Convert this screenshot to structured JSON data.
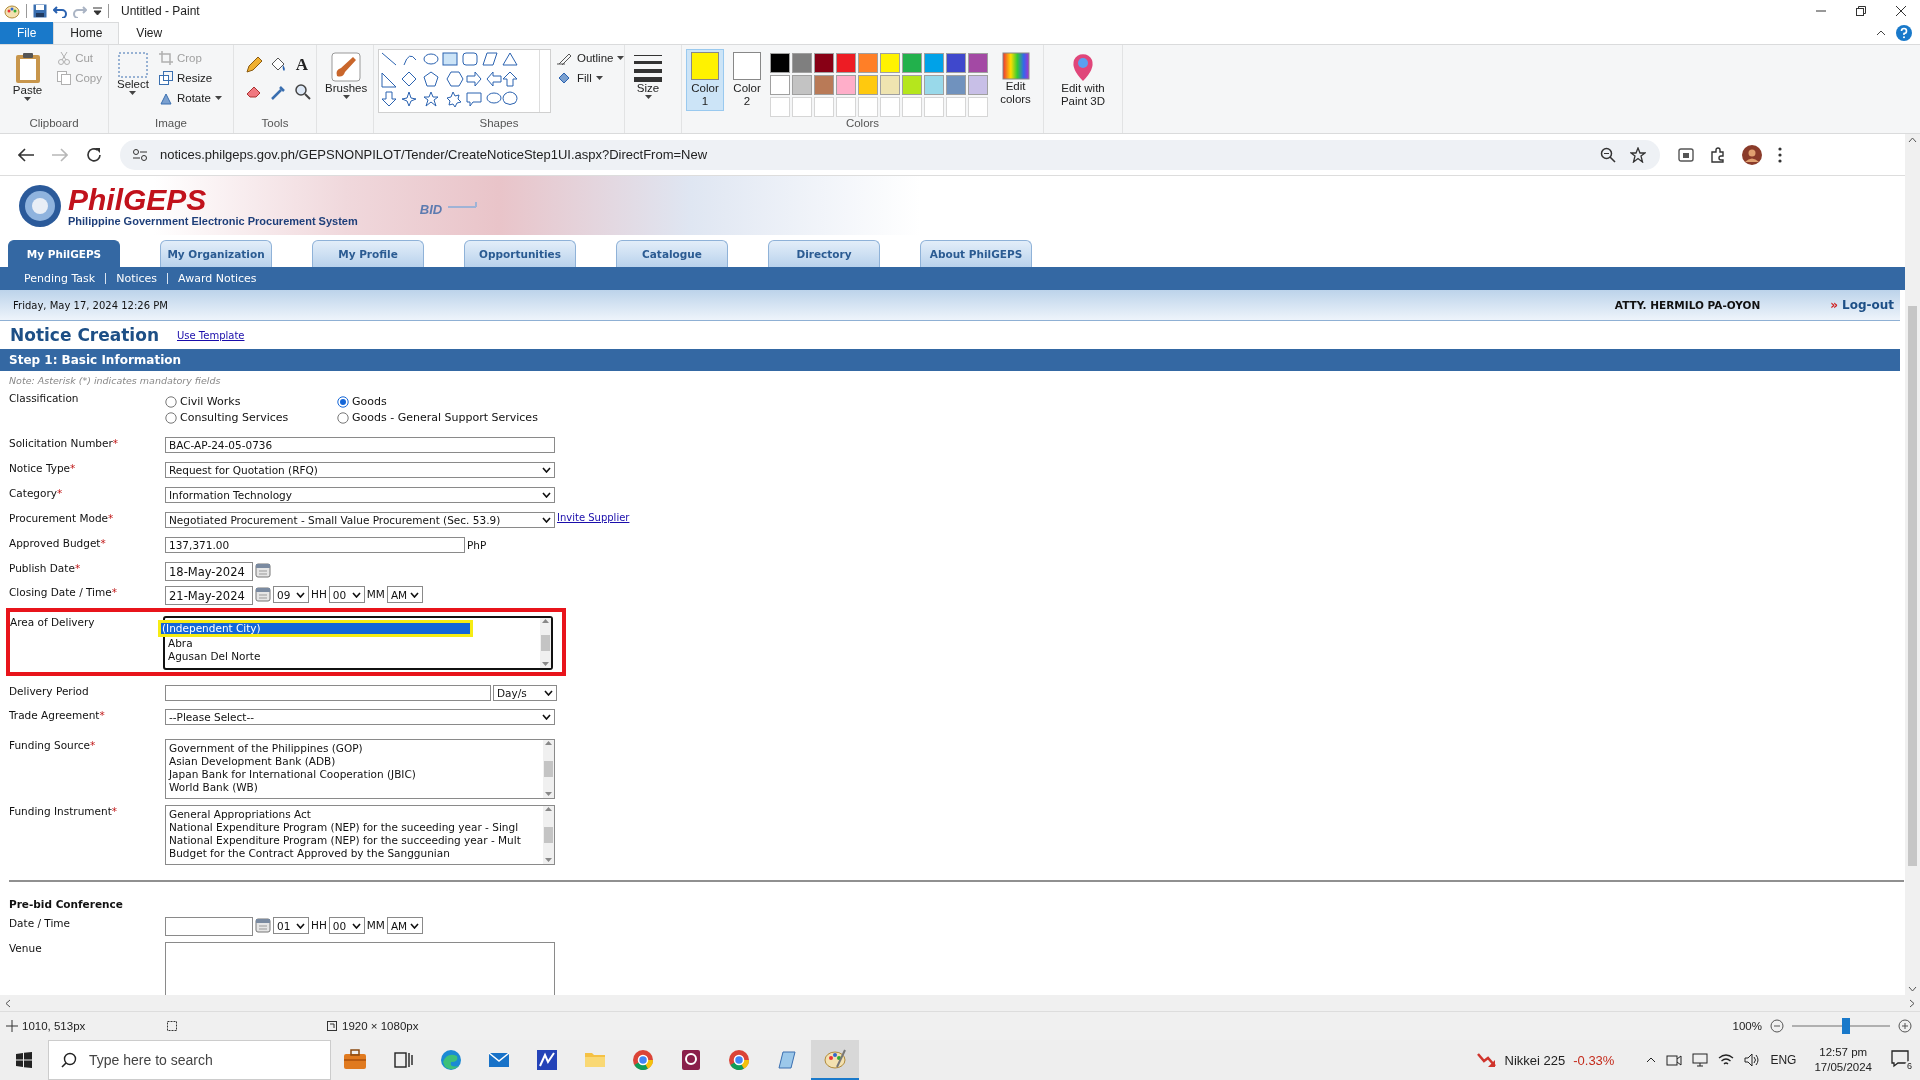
{
  "paint": {
    "title": "Untitled - Paint",
    "menu_tabs": [
      {
        "label": "File",
        "kind": "file",
        "selected": false
      },
      {
        "label": "Home",
        "kind": "tab",
        "selected": true
      },
      {
        "label": "View",
        "kind": "tab",
        "selected": false
      }
    ],
    "ribbon": {
      "paste": "Paste",
      "cut": {
        "label": "Cut",
        "disabled": true
      },
      "copy": {
        "label": "Copy",
        "disabled": true
      },
      "clipboard_label": "Clipboard",
      "select": "Select",
      "crop": {
        "label": "Crop",
        "disabled": true
      },
      "resize": {
        "label": "Resize",
        "disabled": false
      },
      "rotate": {
        "label": "Rotate",
        "disabled": false
      },
      "image_label": "Image",
      "text_tool": "A",
      "tools_label": "Tools",
      "brushes": "Brushes",
      "outline": "Outline",
      "fill": "Fill",
      "shapes_label": "Shapes",
      "size": "Size",
      "color1": {
        "label": "Color 1",
        "color": "#fff200",
        "selected": true
      },
      "color2": {
        "label": "Color 2",
        "color": "#ffffff",
        "selected": false
      },
      "palette": [
        {
          "color": "#000000"
        },
        {
          "color": "#7f7f7f"
        },
        {
          "color": "#880015"
        },
        {
          "color": "#ed1c24"
        },
        {
          "color": "#ff7f27"
        },
        {
          "color": "#fff200"
        },
        {
          "color": "#22b14c"
        },
        {
          "color": "#00a2e8"
        },
        {
          "color": "#3f48cc"
        },
        {
          "color": "#a349a4"
        },
        {
          "color": "#ffffff"
        },
        {
          "color": "#c3c3c3"
        },
        {
          "color": "#b97a57"
        },
        {
          "color": "#ffaec9"
        },
        {
          "color": "#ffc90e"
        },
        {
          "color": "#efe4b0"
        },
        {
          "color": "#b5e61d"
        },
        {
          "color": "#99d9ea"
        },
        {
          "color": "#7092be"
        },
        {
          "color": "#c8bfe7"
        }
      ],
      "edit_colors": "Edit colors",
      "colors_label": "Colors",
      "paint3d": "Edit with Paint 3D"
    }
  },
  "browser": {
    "url": "notices.philgeps.gov.ph/GEPSNONPILOT/Tender/CreateNoticeStep1UI.aspx?DirectFrom=New",
    "forward_disabled": true
  },
  "site": {
    "logo_title": "PhilGEPS",
    "logo_subtitle": "Philippine Government Electronic Procurement System",
    "banner_text": "BID",
    "tabs": [
      {
        "label": "My PhilGEPS",
        "selected": true
      },
      {
        "label": "My Organization",
        "selected": false
      },
      {
        "label": "My Profile",
        "selected": false
      },
      {
        "label": "Opportunities",
        "selected": false
      },
      {
        "label": "Catalogue",
        "selected": false
      },
      {
        "label": "Directory",
        "selected": false
      },
      {
        "label": "About PhilGEPS",
        "selected": false
      }
    ],
    "subnav": [
      "Pending Task",
      "Notices",
      "Award Notices"
    ],
    "date": "Friday, May 17, 2024 12:26 PM",
    "user": "ATTY. HERMILO PA-OYON",
    "logout_mark": "»",
    "logout": "Log-out",
    "heading": "Notice Creation",
    "template_link": "Use Template",
    "step": "Step 1: Basic Information",
    "note": "Note: Asterisk (*) indicates mandatory fields",
    "fields": [
      {
        "kind": "radio",
        "label": "Classification",
        "annotated": false,
        "options": [
          {
            "label": "Civil Works",
            "selected": false
          },
          {
            "label": "Goods",
            "selected": true
          },
          {
            "label": "Consulting Services",
            "selected": false
          },
          {
            "label": "Goods - General Support Services",
            "selected": false
          }
        ]
      },
      {
        "kind": "text",
        "label": "Solicitation Number",
        "mark": "*",
        "annotated": false,
        "value": "BAC-AP-24-05-0736"
      },
      {
        "kind": "select",
        "label": "Notice Type",
        "mark": "*",
        "annotated": false,
        "value": "Request for Quotation (RFQ)"
      },
      {
        "kind": "select",
        "label": "Category",
        "mark": "*",
        "annotated": false,
        "value": "Information Technology"
      },
      {
        "kind": "select",
        "label": "Procurement Mode",
        "mark": "*",
        "annotated": false,
        "value": "Negotiated Procurement - Small Value Procurement (Sec. 53.9)",
        "link": "Invite Supplier"
      },
      {
        "kind": "text",
        "label": "Approved Budget",
        "mark": "*",
        "annotated": false,
        "value": "137,371.00",
        "suffix": "PhP"
      },
      {
        "kind": "date",
        "label": "Publish Date",
        "mark": "*",
        "annotated": false,
        "value": "18-May-2024"
      },
      {
        "kind": "datetime",
        "label": "Closing Date / Time",
        "mark": "*",
        "annotated": false,
        "value": "21-May-2024",
        "hour": "09",
        "hour_unit": "HH",
        "minute": "00",
        "minute_unit": "MM",
        "ampm": "AM"
      },
      {
        "kind": "listbox",
        "label": "Area of Delivery",
        "annotated": true,
        "options": [
          {
            "label": "(Independent City)",
            "selected": true,
            "annotated": true
          },
          {
            "label": "Abra",
            "selected": false,
            "annotated": false
          },
          {
            "label": "Agusan Del Norte",
            "selected": false,
            "annotated": false
          }
        ]
      },
      {
        "kind": "period",
        "label": "Delivery Period",
        "annotated": false,
        "unit": "Day/s"
      },
      {
        "kind": "select",
        "label": "Trade Agreement",
        "mark": "*",
        "annotated": false,
        "value": "--Please Select--"
      },
      {
        "kind": "listbox",
        "label": "Funding Source",
        "mark": "*",
        "annotated": false,
        "options": [
          {
            "label": "Government of the Philippines (GOP)",
            "selected": false
          },
          {
            "label": "Asian Development Bank (ADB)",
            "selected": false
          },
          {
            "label": "Japan Bank for International Cooperation (JBIC)",
            "selected": false
          },
          {
            "label": "World Bank (WB)",
            "selected": false
          }
        ]
      },
      {
        "kind": "listbox",
        "label": "Funding Instrument",
        "mark": "*",
        "annotated": false,
        "options": [
          {
            "label": "General Appropriations Act",
            "selected": false
          },
          {
            "label": "National Expenditure Program (NEP) for the suceeding year - Singl",
            "selected": false
          },
          {
            "label": "National Expenditure Program (NEP) for the succeeding year - Mult",
            "selected": false
          },
          {
            "label": "Budget for the Contract Approved by the Sanggunian",
            "selected": false
          }
        ]
      }
    ],
    "prebid": {
      "title": "Pre-bid Conference",
      "fields": [
        {
          "kind": "datetime",
          "label": "Date / Time",
          "annotated": false,
          "hour": "01",
          "hour_unit": "HH",
          "minute": "00",
          "minute_unit": "MM",
          "ampm": "AM"
        },
        {
          "kind": "textarea",
          "label": "Venue",
          "annotated": false
        }
      ]
    }
  },
  "status_bar": {
    "position": "1010, 513px",
    "size": "1920 × 1080px",
    "zoom": "100%",
    "level": 0.55
  },
  "taskbar": {
    "search_placeholder": "Type here to search",
    "apps": [
      {
        "kind": "briefcase",
        "active": false
      },
      {
        "kind": "taskview",
        "active": false
      },
      {
        "kind": "edge",
        "active": false
      },
      {
        "kind": "mail",
        "active": false
      },
      {
        "kind": "chart",
        "active": false
      },
      {
        "kind": "folder",
        "active": false
      },
      {
        "kind": "chrome",
        "active": false
      },
      {
        "kind": "pdf",
        "active": false
      },
      {
        "kind": "chrome",
        "active": false
      },
      {
        "kind": "notepad",
        "active": false
      },
      {
        "kind": "paint",
        "active": true
      }
    ],
    "ticker_name": "Nikkei 225",
    "ticker_change": "-0.33%",
    "language": "ENG",
    "time": "12:57 pm",
    "date": "17/05/2024",
    "notifications": "6"
  }
}
